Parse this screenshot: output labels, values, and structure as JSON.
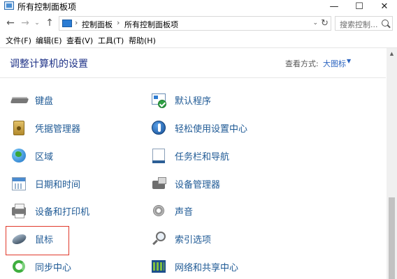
{
  "window": {
    "title": "所有控制面板项",
    "minimize_glyph": "—",
    "maximize_glyph": "☐",
    "close_glyph": "✕"
  },
  "address_bar": {
    "back_glyph": "←",
    "forward_glyph": "→",
    "dropdown_glyph": "⌄",
    "up_glyph": "↑",
    "separator": "›",
    "crumbs": [
      "控制面板",
      "所有控制面板项"
    ],
    "dropdown_caret": "⌄",
    "refresh_glyph": "↻"
  },
  "search": {
    "placeholder": "搜索控制..."
  },
  "menu": [
    "文件(F)",
    "编辑(E)",
    "查看(V)",
    "工具(T)",
    "帮助(H)"
  ],
  "content": {
    "heading": "调整计算机的设置",
    "view_by_label": "查看方式:",
    "view_by_value": "大图标",
    "view_by_caret": "▼"
  },
  "items": {
    "left": [
      {
        "label": "键盘",
        "icon": "keyboard-icon"
      },
      {
        "label": "凭据管理器",
        "icon": "credential-vault-icon"
      },
      {
        "label": "区域",
        "icon": "globe-icon"
      },
      {
        "label": "日期和时间",
        "icon": "calendar-clock-icon"
      },
      {
        "label": "设备和打印机",
        "icon": "printer-icon"
      },
      {
        "label": "鼠标",
        "icon": "mouse-icon"
      },
      {
        "label": "同步中心",
        "icon": "sync-icon"
      }
    ],
    "right": [
      {
        "label": "默认程序",
        "icon": "default-programs-icon"
      },
      {
        "label": "轻松使用设置中心",
        "icon": "accessibility-icon"
      },
      {
        "label": "任务栏和导航",
        "icon": "taskbar-icon"
      },
      {
        "label": "设备管理器",
        "icon": "device-manager-icon"
      },
      {
        "label": "声音",
        "icon": "speaker-icon"
      },
      {
        "label": "索引选项",
        "icon": "magnifier-icon"
      },
      {
        "label": "网络和共享中心",
        "icon": "network-icon"
      }
    ]
  },
  "highlight_color": "#e0392b",
  "link_color": "#1f5a95",
  "scrollbar": {
    "up_glyph": "▲"
  }
}
